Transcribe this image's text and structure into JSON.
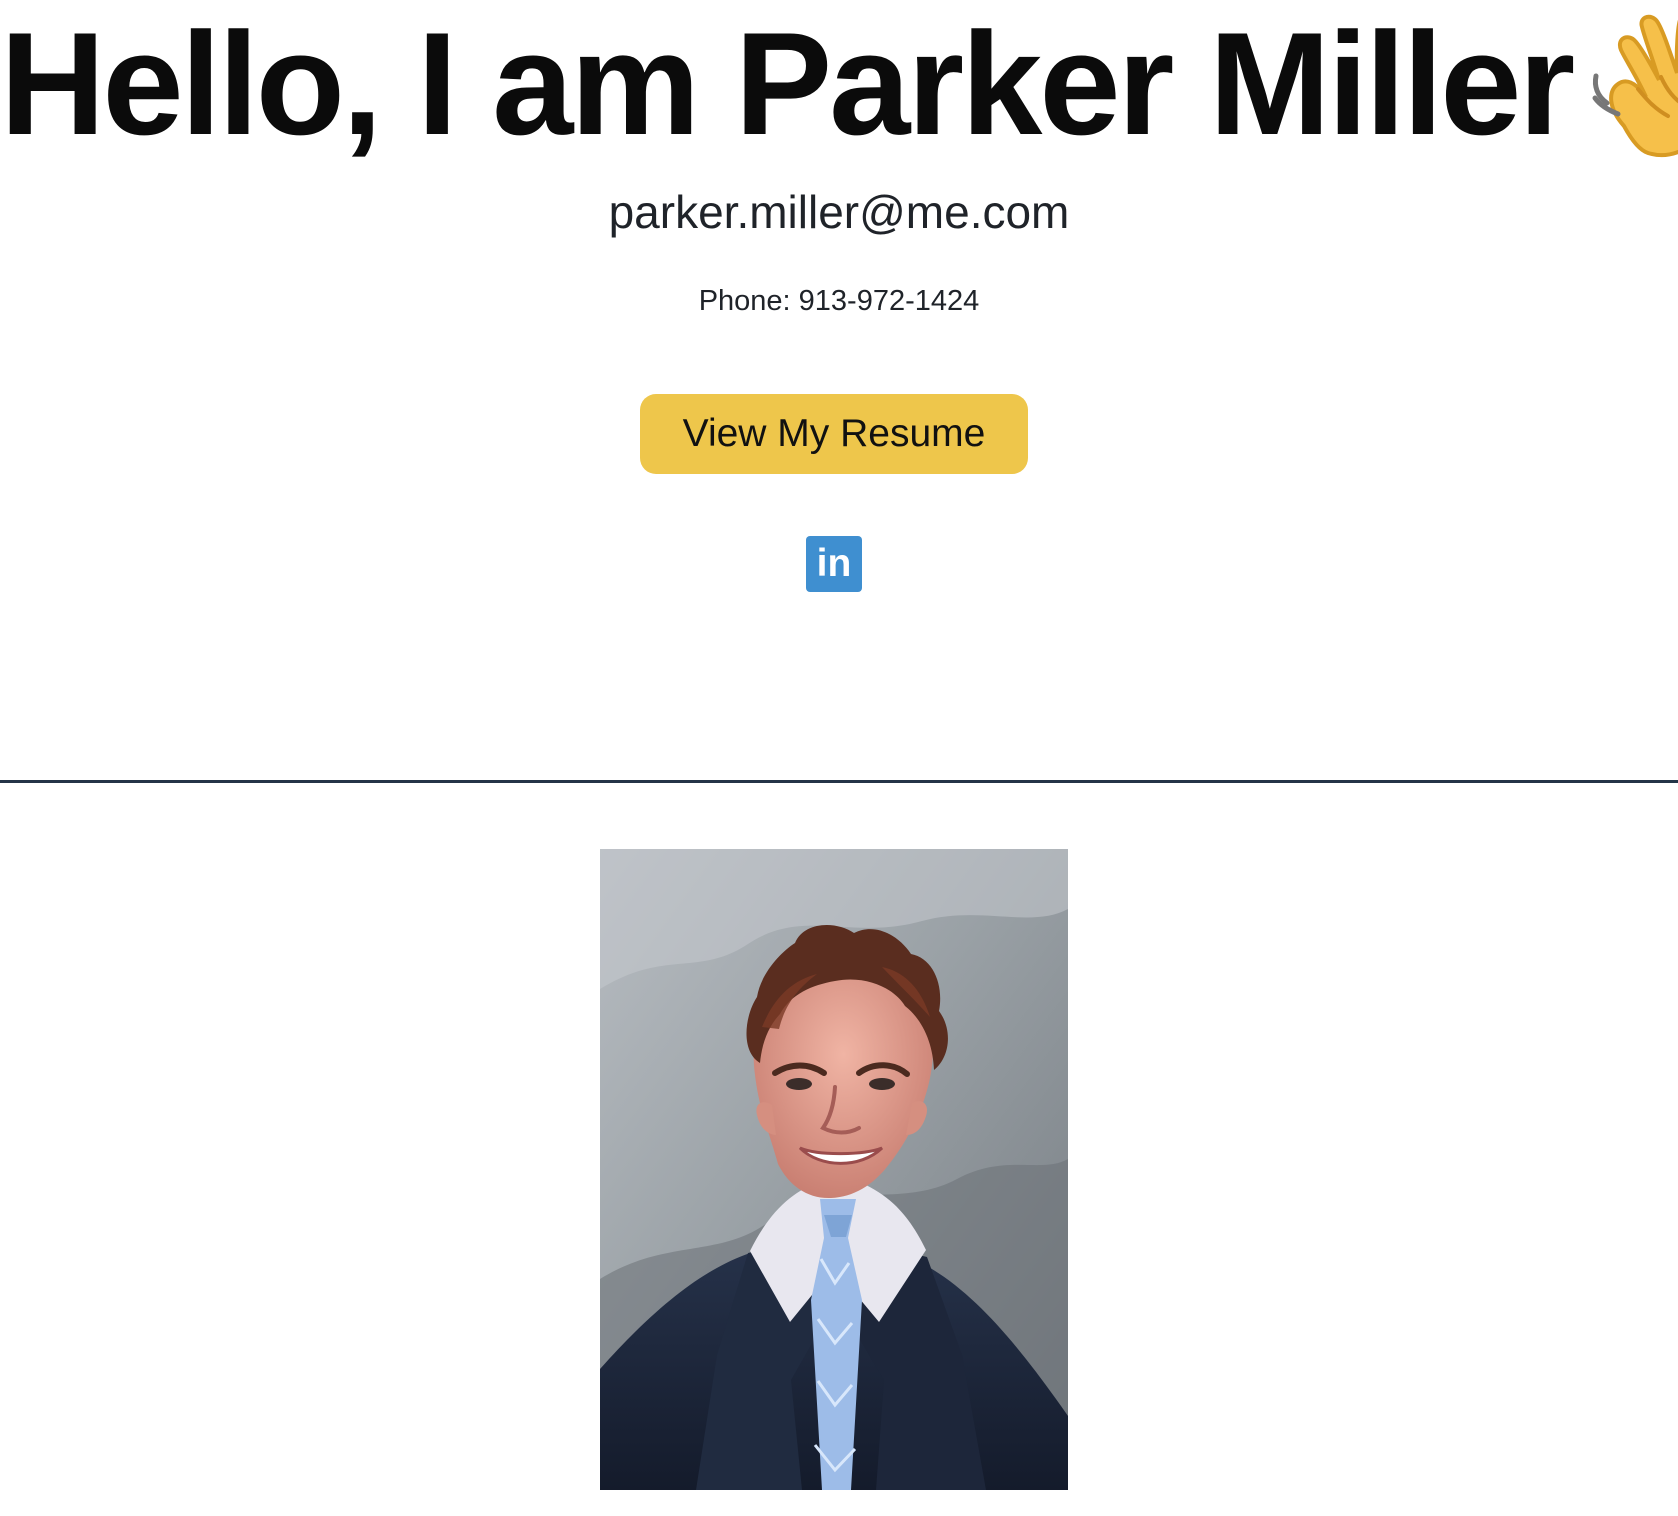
{
  "hero": {
    "title": "Hello, I am Parker Miller",
    "wave_icon": "waving-hand-icon",
    "email": "parker.miller@me.com",
    "phone": "Phone: 913-972-1424",
    "resume_button": "View My Resume",
    "linkedin_label": "in",
    "linkedin_icon": "linkedin-icon"
  },
  "photo": {
    "icon": "portrait-photo"
  },
  "colors": {
    "button": "#eec64b",
    "linkedin": "#3f8fd0",
    "divider": "#243447"
  }
}
